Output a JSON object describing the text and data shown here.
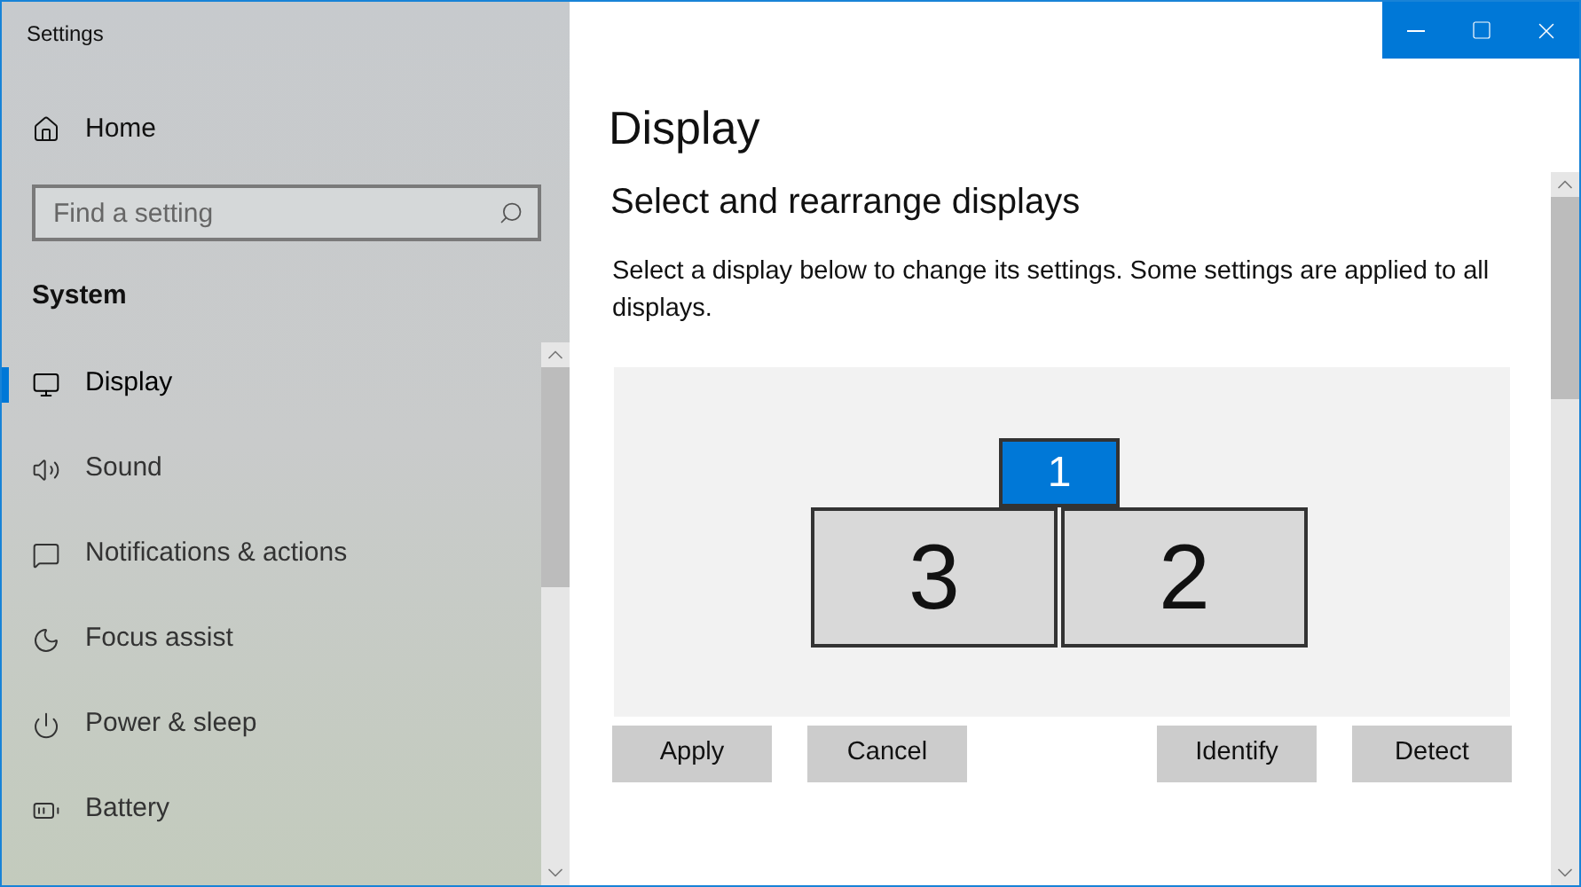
{
  "window": {
    "title": "Settings"
  },
  "sidebar": {
    "home": "Home",
    "search": {
      "placeholder": "Find a setting"
    },
    "section": "System",
    "items": [
      {
        "label": "Display",
        "selected": true
      },
      {
        "label": "Sound",
        "selected": false
      },
      {
        "label": "Notifications & actions",
        "selected": false
      },
      {
        "label": "Focus assist",
        "selected": false
      },
      {
        "label": "Power & sleep",
        "selected": false
      },
      {
        "label": "Battery",
        "selected": false
      }
    ]
  },
  "page": {
    "title": "Display",
    "heading": "Select and rearrange displays",
    "description": "Select a display below to change its settings. Some settings are applied to all displays.",
    "monitors": [
      {
        "label": "1",
        "selected": true
      },
      {
        "label": "3",
        "selected": false
      },
      {
        "label": "2",
        "selected": false
      }
    ],
    "buttons": [
      "Apply",
      "Cancel",
      "Identify",
      "Detect"
    ]
  }
}
